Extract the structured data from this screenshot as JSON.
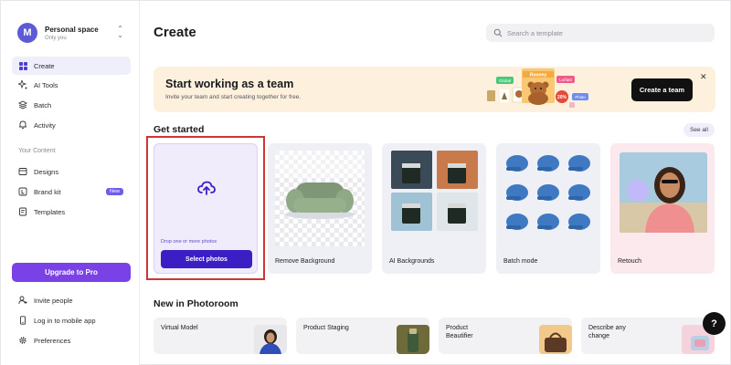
{
  "workspace": {
    "name": "Personal space",
    "subtitle": "Only you",
    "avatar_letter": "M"
  },
  "sidebar": {
    "nav": [
      {
        "label": "Create",
        "icon": "grid-icon",
        "active": true
      },
      {
        "label": "AI Tools",
        "icon": "sparkle-icon"
      },
      {
        "label": "Batch",
        "icon": "layers-icon"
      },
      {
        "label": "Activity",
        "icon": "bell-icon"
      }
    ],
    "content_section_label": "Your Content",
    "content": [
      {
        "label": "Designs",
        "icon": "folder-icon"
      },
      {
        "label": "Brand kit",
        "icon": "brand-kit-icon",
        "badge": "New"
      },
      {
        "label": "Templates",
        "icon": "templates-icon"
      }
    ],
    "upgrade_label": "Upgrade to Pro",
    "footer": [
      {
        "label": "Invite people",
        "icon": "add-user-icon"
      },
      {
        "label": "Log in to mobile app",
        "icon": "phone-icon"
      },
      {
        "label": "Preferences",
        "icon": "gear-icon"
      }
    ]
  },
  "header": {
    "title": "Create",
    "search_placeholder": "Search a template"
  },
  "banner": {
    "title": "Start working as a team",
    "subtitle": "Invite your team and start creating together for free.",
    "button": "Create a team",
    "art_tags": [
      "Global",
      "Lorfant",
      "20%",
      "Photo",
      "Rooney"
    ]
  },
  "get_started": {
    "title": "Get started",
    "see_all": "See all",
    "upload": {
      "drop_text": "Drop one or more photos",
      "button": "Select photos"
    },
    "cards": [
      {
        "label": "Remove Background"
      },
      {
        "label": "AI Backgrounds"
      },
      {
        "label": "Batch mode"
      },
      {
        "label": "Retouch"
      }
    ]
  },
  "new_section": {
    "title": "New in Photoroom",
    "items": [
      {
        "label": "Virtual Model"
      },
      {
        "label": "Product Staging"
      },
      {
        "label": "Product\nBeautifier"
      },
      {
        "label": "Describe any\nchange"
      }
    ]
  },
  "help_button": "?",
  "colors": {
    "accent": "#7a41e6",
    "primary_button": "#3b1fc4",
    "banner_bg": "#fdf1dd",
    "highlight_outline": "#d03535"
  }
}
